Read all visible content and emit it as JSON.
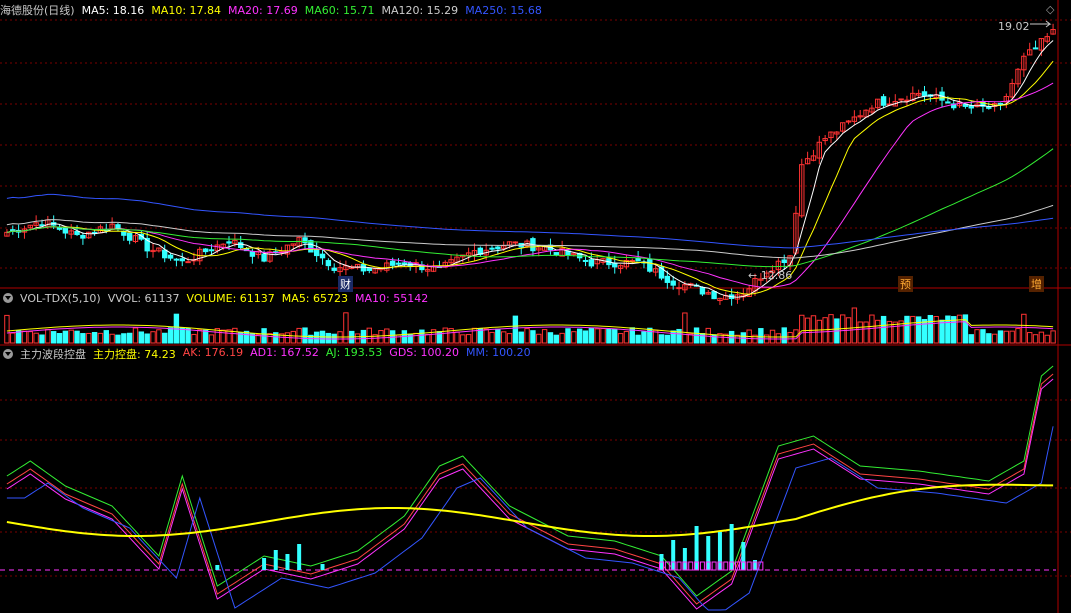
{
  "price_panel": {
    "title": "海德股份(日线)",
    "indicators": [
      {
        "label": "MA5: 18.16",
        "color": "#ffffff"
      },
      {
        "label": "MA10: 17.84",
        "color": "#ffff00"
      },
      {
        "label": "MA20: 17.69",
        "color": "#ff33ff"
      },
      {
        "label": "MA60: 15.71",
        "color": "#33ee33"
      },
      {
        "label": "MA120: 15.29",
        "color": "#cccccc"
      },
      {
        "label": "MA250: 15.68",
        "color": "#3355ff"
      }
    ],
    "high_label": "19.02",
    "low_label": "12.86",
    "event_marks": [
      "财",
      "预",
      "增"
    ]
  },
  "volume_panel": {
    "title": "VOL-TDX(5,10)",
    "indicators": [
      {
        "label": "VVOL: 61137",
        "color": "#c8c8c8"
      },
      {
        "label": "VOLUME: 61137",
        "color": "#ffff00"
      },
      {
        "label": "MA5: 65723",
        "color": "#ffff00"
      },
      {
        "label": "MA10: 55142",
        "color": "#ff33ff"
      }
    ]
  },
  "indicator_panel": {
    "title": "主力波段控盘",
    "indicators": [
      {
        "label": "主力控盘: 74.23",
        "color": "#ffff00"
      },
      {
        "label": "AK: 176.19",
        "color": "#ff4444"
      },
      {
        "label": "AD1: 167.52",
        "color": "#ff33ff"
      },
      {
        "label": "AJ: 193.53",
        "color": "#33ee33"
      },
      {
        "label": "GDS: 100.20",
        "color": "#ff33ff"
      },
      {
        "label": "MM: 100.20",
        "color": "#3355ff"
      }
    ]
  },
  "colors": {
    "up": "#ff3333",
    "down": "#33ffff",
    "grid": "#7a0000",
    "background": "#000000"
  },
  "chart_data": [
    {
      "type": "candlestick",
      "title": "海德股份(日线)",
      "ylim": [
        12.3,
        19.6
      ],
      "high": 19.02,
      "low": 12.86,
      "ma": {
        "MA5": 18.16,
        "MA10": 17.84,
        "MA20": 17.69,
        "MA60": 15.71,
        "MA120": 15.29,
        "MA250": 15.68
      }
    },
    {
      "type": "bar",
      "title": "VOL-TDX(5,10)",
      "values": {
        "VVOL": 61137,
        "VOLUME": 61137,
        "MA5": 65723,
        "MA10": 55142
      }
    },
    {
      "type": "line",
      "title": "主力波段控盘",
      "values": {
        "主力控盘": 74.23,
        "AK": 176.19,
        "AD1": 167.52,
        "AJ": 193.53,
        "GDS": 100.2,
        "MM": 100.2
      }
    }
  ]
}
